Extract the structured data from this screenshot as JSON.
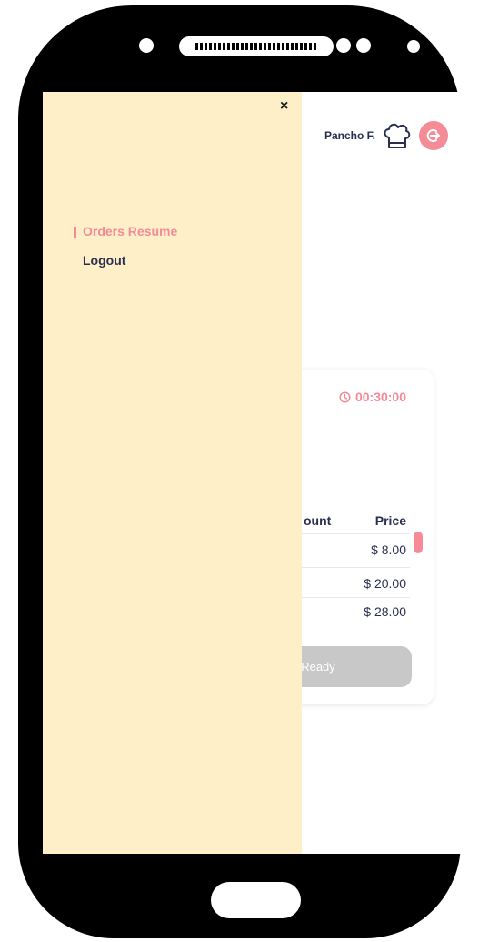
{
  "header": {
    "user_name": "Pancho F.",
    "chef_icon": "chef-hat-icon",
    "logout_icon": "logout-icon"
  },
  "order": {
    "timer": "00:30:00",
    "timer_icon": "clock-icon",
    "columns": [
      "ount",
      "Price"
    ],
    "prices": [
      "$  8.00",
      "$ 20.00",
      "$ 28.00"
    ],
    "ready_label": "Ready"
  },
  "drawer": {
    "close_label": "×",
    "items": [
      {
        "label": "Orders Resume",
        "active": true
      },
      {
        "label": "Logout",
        "active": false
      }
    ]
  },
  "colors": {
    "accent": "#f58b96",
    "drawer_bg": "#feefc8",
    "text_dark": "#2a2f4f",
    "button_disabled": "#c8c8c8"
  }
}
